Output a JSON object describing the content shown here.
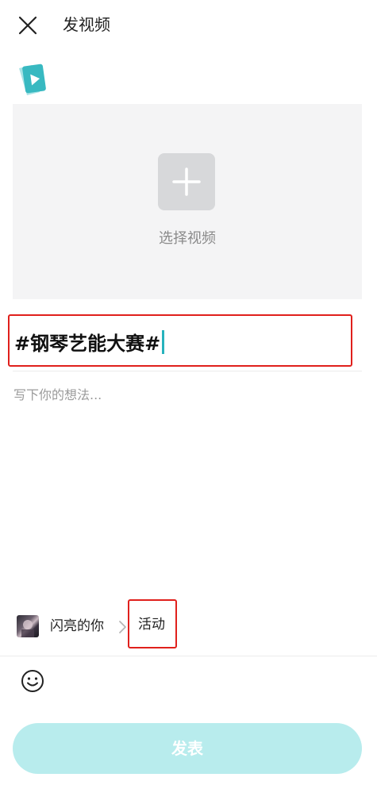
{
  "header": {
    "close_icon": "close-icon",
    "title": "发视频"
  },
  "video_picker": {
    "badge_icon": "video-file-icon",
    "plus_icon": "plus-icon",
    "label": "选择视频"
  },
  "title_field": {
    "value": "#钢琴艺能大赛#"
  },
  "description_field": {
    "placeholder": "写下你的想法..."
  },
  "author": {
    "name": "闪亮的你",
    "separator_icon": "chevron-right-icon"
  },
  "activity": {
    "label": "活动"
  },
  "toolbar": {
    "emoji_icon": "smiley-icon"
  },
  "publish": {
    "label": "发表"
  },
  "colors": {
    "accent": "#27b3bd",
    "publish_disabled": "#b8eced",
    "highlight_border": "#e0201c"
  }
}
